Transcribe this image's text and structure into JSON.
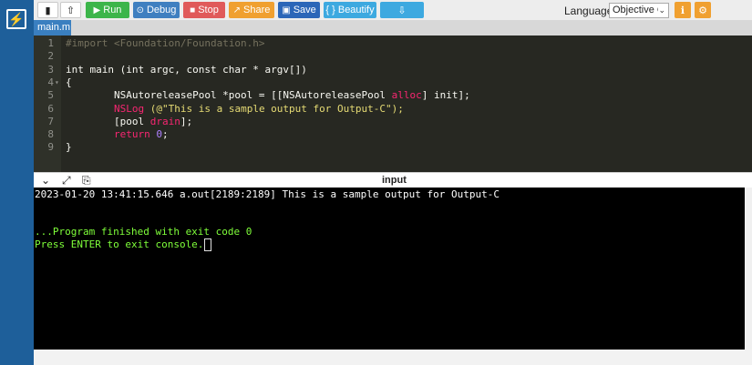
{
  "toolbar": {
    "new_icon": "file-icon",
    "upload_icon": "upload-icon",
    "run_label": "Run",
    "debug_label": "Debug",
    "stop_label": "Stop",
    "share_label": "Share",
    "save_label": "Save",
    "beautify_label": "{ } Beautify",
    "download_icon": "download-icon",
    "language_label": "Language",
    "language_value": "Objective C",
    "colors": {
      "run": "#3cb54a",
      "debug": "#3f7fc0",
      "stop": "#e05a5a",
      "share": "#f0a030",
      "save": "#2b66b8",
      "beautify": "#3da9e0",
      "download": "#3da9e0"
    }
  },
  "tab": {
    "label": "main.m"
  },
  "editor": {
    "lines": [
      {
        "num": "1",
        "fold": ""
      },
      {
        "num": "2",
        "fold": ""
      },
      {
        "num": "3",
        "fold": ""
      },
      {
        "num": "4",
        "fold": "▾"
      },
      {
        "num": "5",
        "fold": ""
      },
      {
        "num": "6",
        "fold": ""
      },
      {
        "num": "7",
        "fold": ""
      },
      {
        "num": "8",
        "fold": ""
      },
      {
        "num": "9",
        "fold": ""
      }
    ],
    "code": {
      "l1_import": "#import",
      "l1_path": "<Foundation/Foundation.h>",
      "l3": "int main (int argc, const char * argv[])",
      "l4": "{",
      "l5_a": "        NSAutoreleasePool *pool = [[NSAutoreleasePool ",
      "l5_alloc": "alloc",
      "l5_b": "] init];",
      "l6_nslog": "NSLog",
      "l6_str": "(@\"This is a sample output for Output-C\");",
      "l7_a": "        [pool ",
      "l7_drain": "drain",
      "l7_b": "];",
      "l8_ret": "return",
      "l8_num": "0",
      "l8_end": ";",
      "l9": "}"
    }
  },
  "console_bar": {
    "collapse_icon": "chevron-down-icon",
    "expand_icon": "expand-icon",
    "copy_icon": "copy-icon",
    "input_label": "input"
  },
  "console": {
    "line1": "2023-01-20 13:41:15.646 a.out[2189:2189] This is a sample output for Output-C",
    "line2": "...Program finished with exit code 0",
    "line3": "Press ENTER to exit console.",
    "colors": {
      "output": "#ffffff",
      "status": "#7fff3a"
    }
  }
}
